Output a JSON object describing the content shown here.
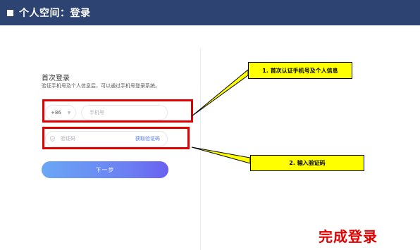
{
  "header": {
    "title": "个人空间：登录",
    "bg_color": "#2d4472"
  },
  "login": {
    "title": "首次登录",
    "subtitle": "验证手机号及个人信息后，可以通过手机号登录系统。",
    "country_code": "+86",
    "phone_placeholder": "手机号",
    "code_placeholder": "验证码",
    "get_code_label": "获取验证码",
    "next_label": "下一步"
  },
  "annotations": {
    "callout_1": "1. 首次认证手机号及个人信息",
    "callout_2": "2. 输入验证码",
    "done_text": "完成登录",
    "highlight_color": "#e00000",
    "callout_color": "#ffff00"
  },
  "icons": {
    "chevron": "chevron-down-icon",
    "shield": "shield-icon"
  }
}
